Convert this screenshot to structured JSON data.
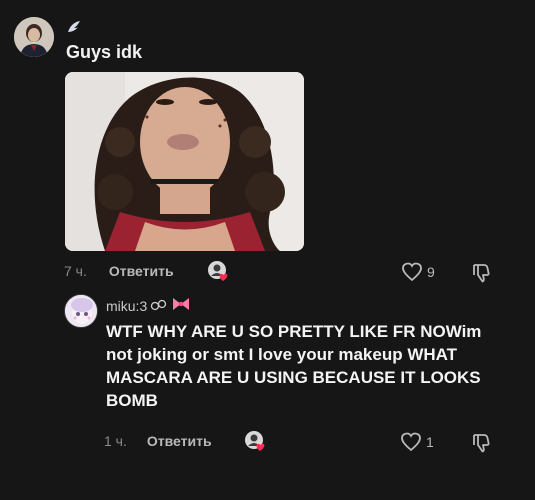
{
  "comment": {
    "caption": "Guys idk",
    "time": "7 ч.",
    "reply_label": "Ответить",
    "likes": "9"
  },
  "reply_comment": {
    "username": "miku:3",
    "text": "WTF WHY ARE U SO PRETTY LIKE FR NOWim not joking or smt I love your makeup WHAT MASCARA ARE U USING BECAUSE IT LOOKS BOMB",
    "time": "1 ч.",
    "reply_label": "Ответить",
    "likes": "1"
  },
  "colors": {
    "background": "#161616",
    "text_primary": "#ffffff",
    "text_muted": "#8a8a8a",
    "heart_badge": "#fe2c55"
  },
  "icons": {
    "wing": "wing-icon",
    "like": "heart-outline-icon",
    "dislike": "thumbs-down-icon",
    "sticker": "creator-liked-badge-icon",
    "username_decor": [
      "chain-icon",
      "bow-icon"
    ]
  }
}
